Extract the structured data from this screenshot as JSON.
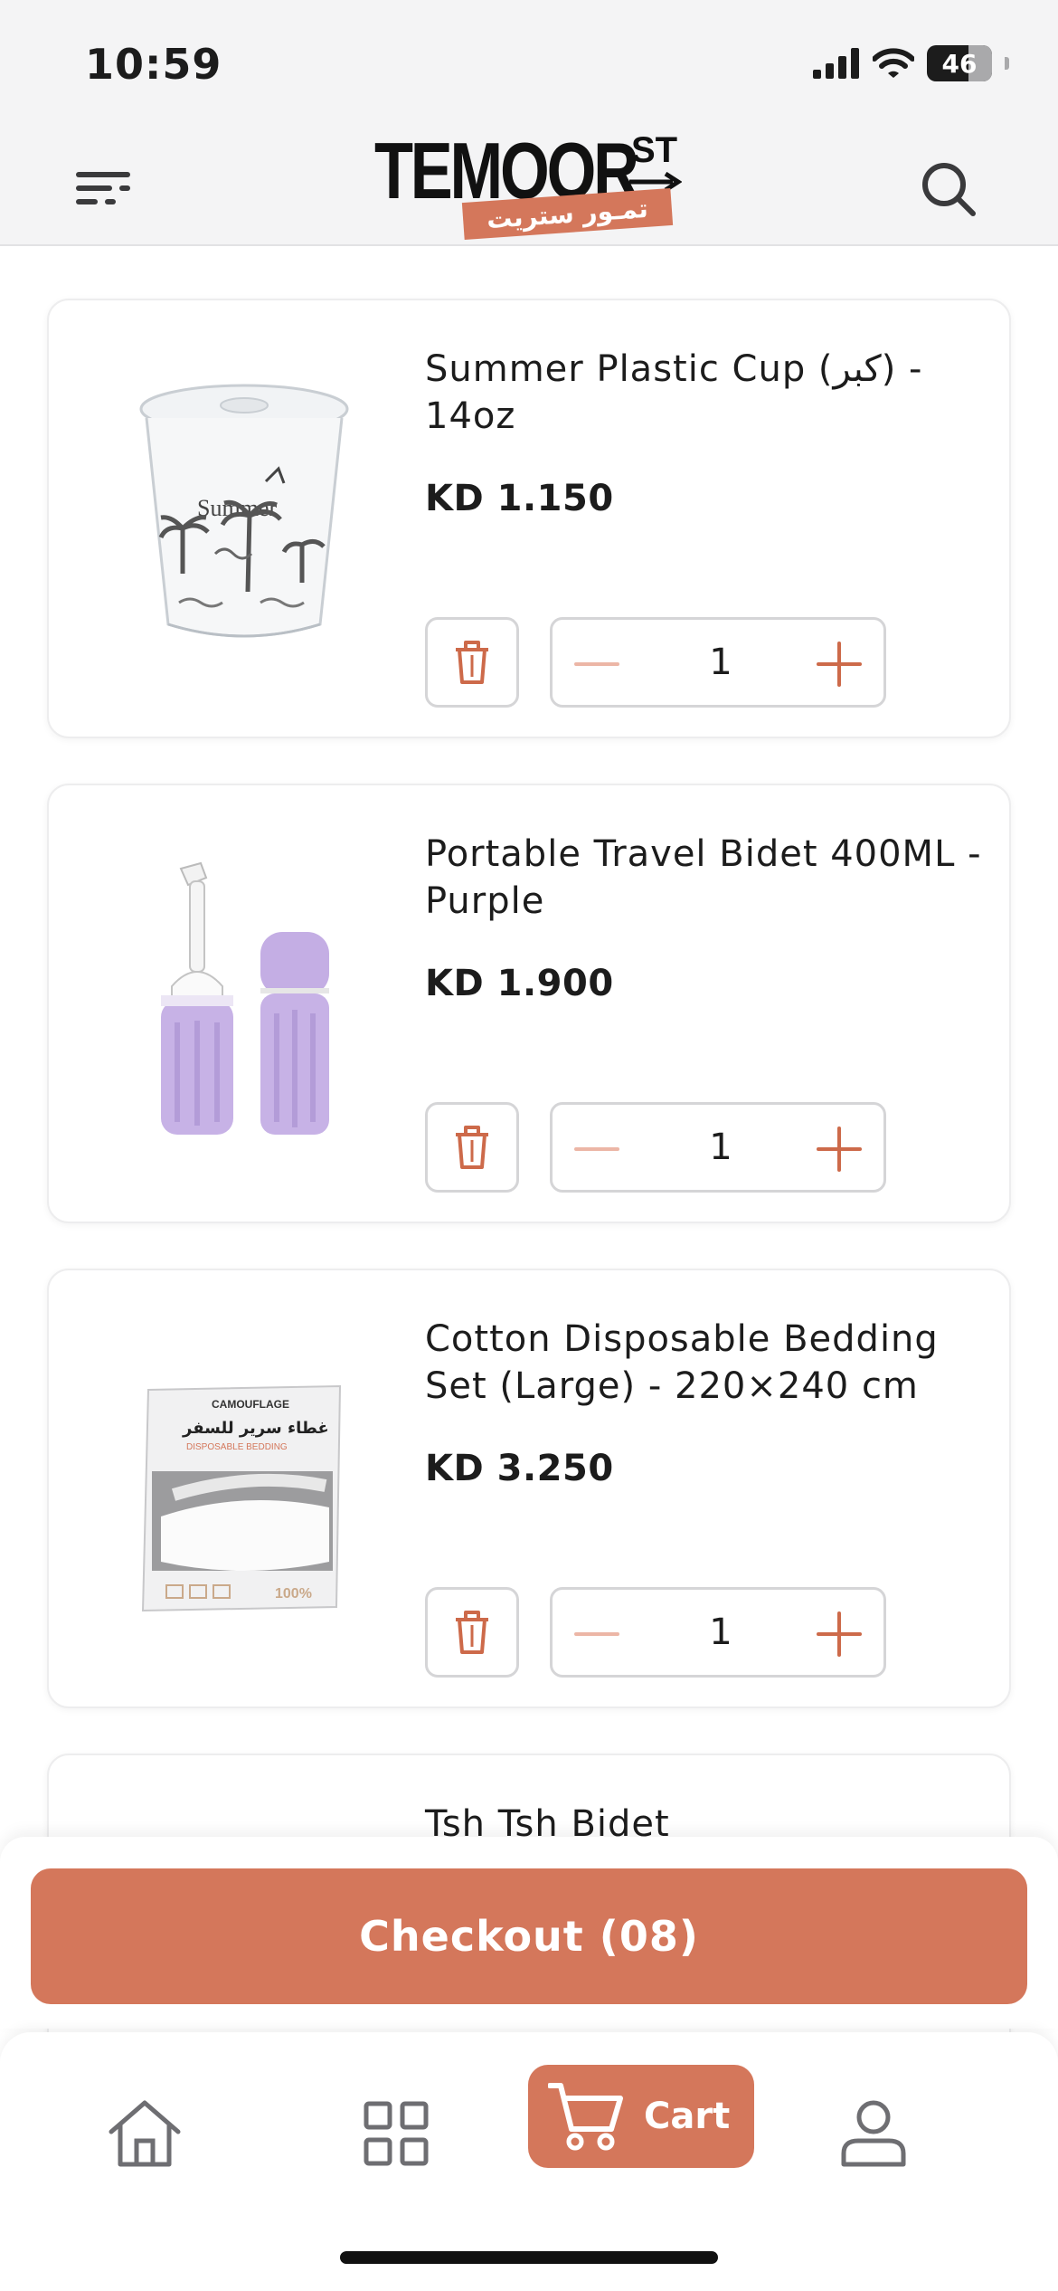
{
  "status_bar": {
    "time": "10:59",
    "battery": "46"
  },
  "header": {
    "logo_text": "TEMOOR",
    "logo_suffix": "ST",
    "logo_arabic": "تمـور ستريت"
  },
  "cart_items": [
    {
      "title": "Summer Plastic Cup (كبر) - 14oz",
      "price": "KD 1.150",
      "quantity": "1"
    },
    {
      "title": "Portable Travel Bidet 400ML - Purple",
      "price": "KD 1.900",
      "quantity": "1"
    },
    {
      "title": "Cotton Disposable Bedding Set (Large) - 220×240 cm",
      "price": "KD 3.250",
      "quantity": "1"
    },
    {
      "title": "Tsh Tsh Bidet"
    }
  ],
  "product_images": {
    "cup_print": "Summer",
    "bedding_brand": "CAMOUFLAGE",
    "bedding_arabic": "غطاء سرير للسفر",
    "bedding_subtitle": "DISPOSABLE BEDDING",
    "bedding_badge": "100%"
  },
  "checkout": {
    "label": "Checkout (08)"
  },
  "tab_bar": {
    "cart_label": "Cart"
  },
  "colors": {
    "accent": "#d4775b",
    "accent_light": "#ecb6a6",
    "text": "#1c1c1c",
    "border": "#d5d5d7"
  },
  "icons": [
    "menu-icon",
    "search-icon",
    "trash-icon",
    "minus-icon",
    "plus-icon",
    "home-icon",
    "grid-icon",
    "cart-icon",
    "user-icon"
  ]
}
